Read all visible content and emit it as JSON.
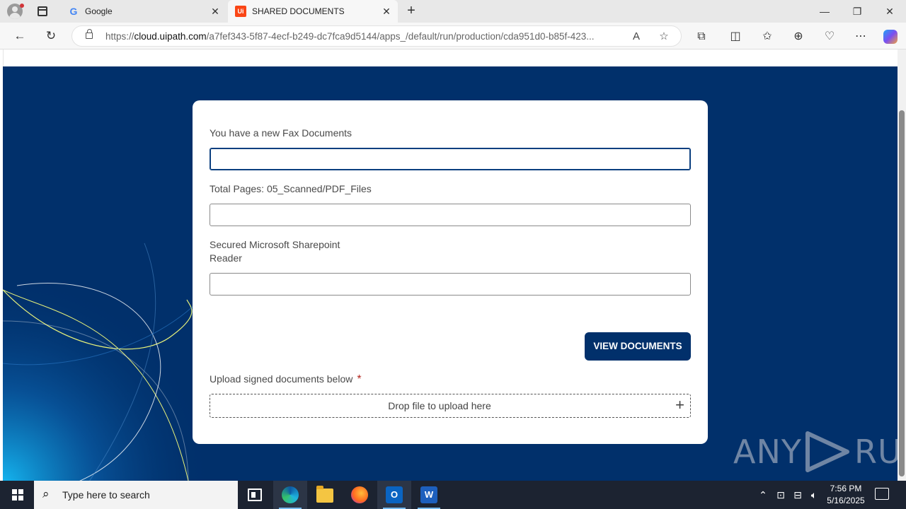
{
  "browser": {
    "tabs": [
      {
        "title": "Google",
        "favicon": "google-icon"
      },
      {
        "title": "SHARED DOCUMENTS",
        "favicon": "uipath-icon",
        "active": true
      }
    ],
    "address": {
      "scheme": "https://",
      "host": "cloud.uipath.com",
      "path": "/a7fef343-5f87-4ecf-b249-dc7fca9d5144/apps_/default/run/production/cda951d0-b85f-423..."
    },
    "uipath_favicon_text": "Ui"
  },
  "form": {
    "field1_label": "You have a new Fax Documents",
    "field1_value": "",
    "field2_label": "Total Pages: 05_Scanned/PDF_Files",
    "field2_value": "",
    "field3_label_line1": "Secured Microsoft Sharepoint",
    "field3_label_line2": "Reader",
    "field3_value": "",
    "view_button": "VIEW DOCUMENTS",
    "upload_label": "Upload signed documents below",
    "required_mark": "*",
    "dropzone_text": "Drop file to upload here"
  },
  "watermark": {
    "left": "ANY",
    "right": "RUN"
  },
  "taskbar": {
    "search_placeholder": "Type here to search",
    "outlook_letter": "O",
    "word_letter": "W",
    "time": "7:56 PM",
    "date": "5/16/2025"
  },
  "colors": {
    "page_background": "#01306b",
    "button": "#01306b",
    "uipath_orange": "#fa4616"
  }
}
